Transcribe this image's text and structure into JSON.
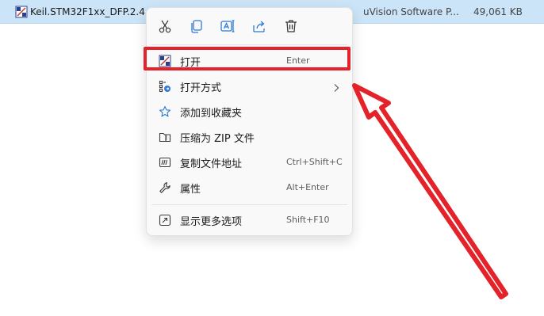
{
  "file": {
    "name": "Keil.STM32F1xx_DFP.2.4.1",
    "type": "uVision Software P...",
    "size": "49,061 KB"
  },
  "toolbar": {
    "icons": [
      "cut-icon",
      "copy-icon",
      "rename-icon",
      "share-icon",
      "delete-icon"
    ]
  },
  "menu": {
    "open": {
      "label": "打开",
      "shortcut": "Enter"
    },
    "open_with": {
      "label": "打开方式"
    },
    "favorites": {
      "label": "添加到收藏夹"
    },
    "zip": {
      "label": "压缩为 ZIP 文件"
    },
    "copy_path": {
      "label": "复制文件地址",
      "shortcut": "Ctrl+Shift+C"
    },
    "properties": {
      "label": "属性",
      "shortcut": "Alt+Enter"
    },
    "more_options": {
      "label": "显示更多选项",
      "shortcut": "Shift+F10"
    }
  },
  "colors": {
    "highlight": "#e4222a",
    "accent": "#2d7ad6",
    "selection": "#cce4f7"
  }
}
